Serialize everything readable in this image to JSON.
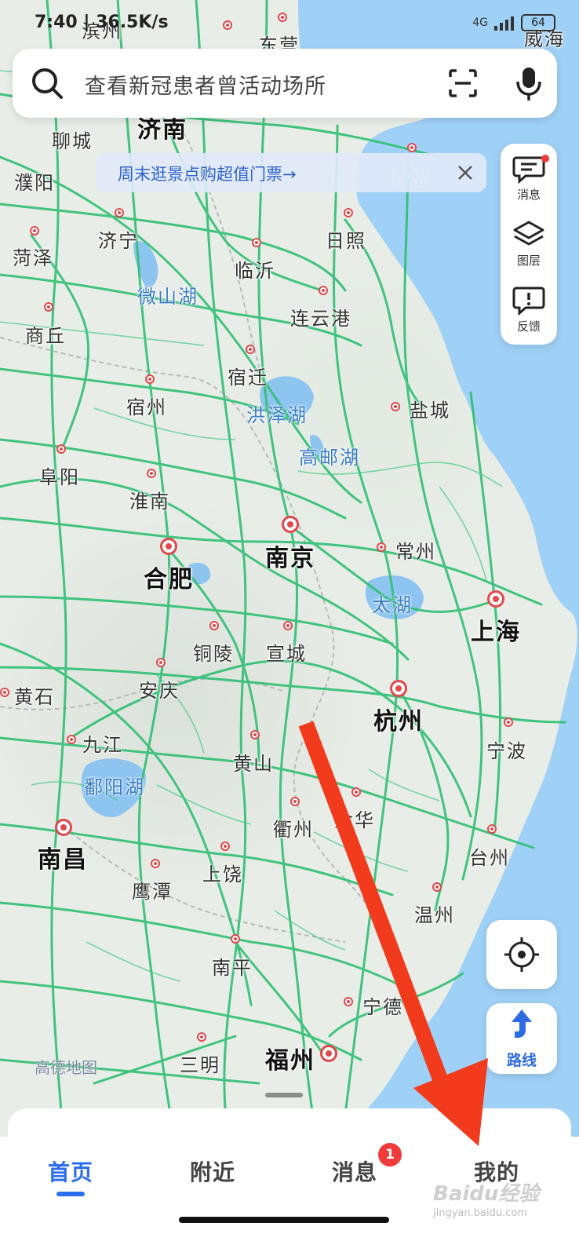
{
  "status": {
    "time": "7:40 | 36.5K/s",
    "network": "4G",
    "battery": "64"
  },
  "search": {
    "placeholder": "查看新冠患者曾活动场所"
  },
  "promo": {
    "text": "周末逛景点购超值门票→"
  },
  "side_panel": {
    "items": [
      {
        "label": "消息",
        "icon": "message-icon"
      },
      {
        "label": "图层",
        "icon": "layers-icon"
      },
      {
        "label": "反馈",
        "icon": "feedback-icon"
      }
    ]
  },
  "map": {
    "cities": [
      {
        "name": "济南"
      },
      {
        "name": "聊城"
      },
      {
        "name": "濮阳"
      },
      {
        "name": "济宁"
      },
      {
        "name": "菏泽"
      },
      {
        "name": "日照"
      },
      {
        "name": "临沂"
      },
      {
        "name": "连云港"
      },
      {
        "name": "商丘"
      },
      {
        "name": "宿迁"
      },
      {
        "name": "宿州"
      },
      {
        "name": "盐城"
      },
      {
        "name": "阜阳"
      },
      {
        "name": "淮南"
      },
      {
        "name": "南京"
      },
      {
        "name": "合肥"
      },
      {
        "name": "常州"
      },
      {
        "name": "上海"
      },
      {
        "name": "铜陵"
      },
      {
        "name": "宣城"
      },
      {
        "name": "安庆"
      },
      {
        "name": "黄石"
      },
      {
        "name": "杭州"
      },
      {
        "name": "九江"
      },
      {
        "name": "宁波"
      },
      {
        "name": "黄山"
      },
      {
        "name": "南昌"
      },
      {
        "name": "衢州"
      },
      {
        "name": "金华"
      },
      {
        "name": "台州"
      },
      {
        "name": "上饶"
      },
      {
        "name": "鹰潭"
      },
      {
        "name": "温州"
      },
      {
        "name": "南平"
      },
      {
        "name": "宁德"
      },
      {
        "name": "三明"
      },
      {
        "name": "福州"
      },
      {
        "name": "青岛"
      },
      {
        "name": "滨州"
      },
      {
        "name": "东营"
      },
      {
        "name": "威海"
      }
    ],
    "lakes": [
      {
        "name": "微山湖"
      },
      {
        "name": "洪泽湖"
      },
      {
        "name": "高邮湖"
      },
      {
        "name": "太湖"
      },
      {
        "name": "鄱阳湖"
      }
    ],
    "watermark": "高德地图"
  },
  "controls": {
    "route_label": "路线"
  },
  "tabs": [
    {
      "label": "首页"
    },
    {
      "label": "附近"
    },
    {
      "label": "消息"
    },
    {
      "label": "我的"
    }
  ],
  "tab_badge": "1",
  "overlay_watermark": {
    "text": "Baidu经验",
    "sub": "jingyan.baidu.com"
  },
  "colors": {
    "accent": "#2b6ef0",
    "road": "#2fbf73",
    "sea": "#9fd0f6",
    "lake": "#8ec4f0",
    "pin": "#e0484c",
    "arrow": "#f23a1d"
  }
}
